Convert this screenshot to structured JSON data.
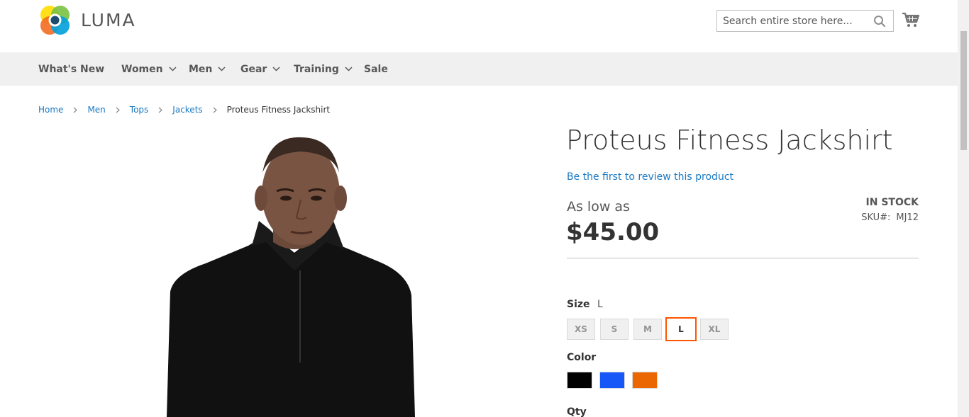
{
  "header": {
    "logo_text": "LUMA",
    "search_placeholder": "Search entire store here...",
    "icons": {
      "search": "search-icon",
      "cart": "cart-icon"
    }
  },
  "nav": {
    "items": [
      {
        "label": "What's New",
        "dropdown": false
      },
      {
        "label": "Women",
        "dropdown": true
      },
      {
        "label": "Men",
        "dropdown": true
      },
      {
        "label": "Gear",
        "dropdown": true
      },
      {
        "label": "Training",
        "dropdown": true
      },
      {
        "label": "Sale",
        "dropdown": false
      }
    ]
  },
  "breadcrumb": {
    "items": [
      "Home",
      "Men",
      "Tops",
      "Jackets",
      "Proteus Fitness Jackshirt"
    ]
  },
  "product": {
    "title": "Proteus Fitness Jackshirt",
    "review_link": "Be the first to review this product",
    "as_low_as": "As low as",
    "price": "$45.00",
    "stock": "IN STOCK",
    "sku_label": "SKU#:",
    "sku": "MJ12",
    "size_label": "Size",
    "size_selected": "L",
    "sizes": [
      "XS",
      "S",
      "M",
      "L",
      "XL"
    ],
    "color_label": "Color",
    "colors": [
      "#000000",
      "#1857f7",
      "#eb6703"
    ],
    "qty_label": "Qty"
  },
  "colors": {
    "link": "#1979c3",
    "selected_border": "#ff5501",
    "nav_bg": "#f0f0f0"
  }
}
